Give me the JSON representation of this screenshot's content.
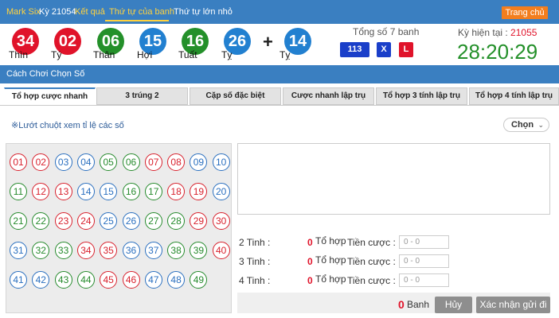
{
  "topbar": {
    "brand": "Mark Six",
    "issue": "Kỳ 21054",
    "result_link": "Kết quả",
    "tabs": [
      "Thứ tự của banh",
      "Thứ tự lớn nhỏ"
    ],
    "active_tab": 0,
    "home": "Trang chủ"
  },
  "results": {
    "balls": [
      {
        "number": "34",
        "zodiac": "Thìn",
        "color": "red"
      },
      {
        "number": "02",
        "zodiac": "Tý",
        "color": "red"
      },
      {
        "number": "06",
        "zodiac": "Thân",
        "color": "green"
      },
      {
        "number": "15",
        "zodiac": "Hợi",
        "color": "blue"
      },
      {
        "number": "16",
        "zodiac": "Tuất",
        "color": "green"
      },
      {
        "number": "26",
        "zodiac": "Tỵ",
        "color": "blue"
      }
    ],
    "plus": "+",
    "special": {
      "number": "14",
      "zodiac": "Tỵ",
      "color": "blue"
    },
    "sum_title": "Tổng số 7 banh",
    "sum_value": "113",
    "sum_x": "X",
    "sum_l": "L",
    "next_issue_label": "Kỳ hiện tại :",
    "next_issue_value": "21055",
    "countdown": "28:20:29"
  },
  "section": {
    "title": "Cách Chơi Chọn Số"
  },
  "play_tabs": [
    "Tổ hợp cược nhanh",
    "3 trúng 2",
    "Cặp số đặc biệt",
    "Cược nhanh lập trụ",
    "Tổ hợp 3 tính lập trụ",
    "Tổ hợp 4 tính lập trụ"
  ],
  "hint": "※Lướt chuột xem tỉ lệ các số",
  "select": {
    "value": "Chọn"
  },
  "numbers": [
    {
      "n": "01",
      "c": "red"
    },
    {
      "n": "02",
      "c": "red"
    },
    {
      "n": "03",
      "c": "blue"
    },
    {
      "n": "04",
      "c": "blue"
    },
    {
      "n": "05",
      "c": "green"
    },
    {
      "n": "06",
      "c": "green"
    },
    {
      "n": "07",
      "c": "red"
    },
    {
      "n": "08",
      "c": "red"
    },
    {
      "n": "09",
      "c": "blue"
    },
    {
      "n": "10",
      "c": "blue"
    },
    {
      "n": "11",
      "c": "green"
    },
    {
      "n": "12",
      "c": "red"
    },
    {
      "n": "13",
      "c": "red"
    },
    {
      "n": "14",
      "c": "blue"
    },
    {
      "n": "15",
      "c": "blue"
    },
    {
      "n": "16",
      "c": "green"
    },
    {
      "n": "17",
      "c": "green"
    },
    {
      "n": "18",
      "c": "red"
    },
    {
      "n": "19",
      "c": "red"
    },
    {
      "n": "20",
      "c": "blue"
    },
    {
      "n": "21",
      "c": "green"
    },
    {
      "n": "22",
      "c": "green"
    },
    {
      "n": "23",
      "c": "red"
    },
    {
      "n": "24",
      "c": "red"
    },
    {
      "n": "25",
      "c": "blue"
    },
    {
      "n": "26",
      "c": "blue"
    },
    {
      "n": "27",
      "c": "green"
    },
    {
      "n": "28",
      "c": "green"
    },
    {
      "n": "29",
      "c": "red"
    },
    {
      "n": "30",
      "c": "red"
    },
    {
      "n": "31",
      "c": "blue"
    },
    {
      "n": "32",
      "c": "green"
    },
    {
      "n": "33",
      "c": "green"
    },
    {
      "n": "34",
      "c": "red"
    },
    {
      "n": "35",
      "c": "red"
    },
    {
      "n": "36",
      "c": "blue"
    },
    {
      "n": "37",
      "c": "blue"
    },
    {
      "n": "38",
      "c": "green"
    },
    {
      "n": "39",
      "c": "green"
    },
    {
      "n": "40",
      "c": "red"
    },
    {
      "n": "41",
      "c": "blue"
    },
    {
      "n": "42",
      "c": "blue"
    },
    {
      "n": "43",
      "c": "green"
    },
    {
      "n": "44",
      "c": "green"
    },
    {
      "n": "45",
      "c": "red"
    },
    {
      "n": "46",
      "c": "red"
    },
    {
      "n": "47",
      "c": "blue"
    },
    {
      "n": "48",
      "c": "blue"
    },
    {
      "n": "49",
      "c": "green"
    }
  ],
  "calc": [
    {
      "label": "2 Tinh :",
      "count": "0",
      "unit": "Tổ hợp",
      "bet_label": "Tiền cược :",
      "placeholder": "0 - 0"
    },
    {
      "label": "3 Tinh :",
      "count": "0",
      "unit": "Tổ hợp",
      "bet_label": "Tiền cược :",
      "placeholder": "0 - 0"
    },
    {
      "label": "4 Tinh :",
      "count": "0",
      "unit": "Tổ hợp",
      "bet_label": "Tiền cược :",
      "placeholder": "0 - 0"
    }
  ],
  "footer": {
    "total_count": "0",
    "total_unit": "Banh",
    "cancel": "Hủy",
    "confirm": "Xác nhận gửi đi"
  },
  "colors": {
    "header_blue": "#3a7fc1",
    "red": "#e0132a",
    "green": "#24902a",
    "blue": "#2280d0",
    "orange": "#f37e1e"
  }
}
